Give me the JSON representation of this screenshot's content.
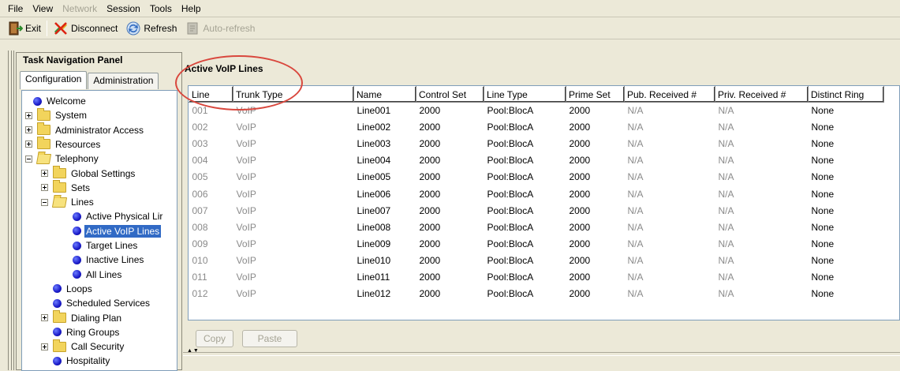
{
  "menu": [
    "File",
    "View",
    "Network",
    "Session",
    "Tools",
    "Help"
  ],
  "menu_disabled": [
    false,
    false,
    true,
    false,
    false,
    false
  ],
  "toolbar": {
    "exit_label": "Exit",
    "disconnect_label": "Disconnect",
    "refresh_label": "Refresh",
    "autorefresh_label": "Auto-refresh"
  },
  "nav": {
    "title": "Task Navigation Panel",
    "tabs": [
      "Configuration",
      "Administration"
    ],
    "active_tab": "Configuration",
    "tree": [
      {
        "label": "Welcome",
        "icon": "blue-dot-icon",
        "depth": 0,
        "expander": "none"
      },
      {
        "label": "System",
        "icon": "folder-icon",
        "depth": 0,
        "expander": "plus"
      },
      {
        "label": "Administrator Access",
        "icon": "folder-icon",
        "depth": 0,
        "expander": "plus"
      },
      {
        "label": "Resources",
        "icon": "folder-icon",
        "depth": 0,
        "expander": "plus"
      },
      {
        "label": "Telephony",
        "icon": "folder-open-icon",
        "depth": 0,
        "expander": "minus"
      },
      {
        "label": "Global Settings",
        "icon": "folder-icon",
        "depth": 1,
        "expander": "plus"
      },
      {
        "label": "Sets",
        "icon": "folder-icon",
        "depth": 1,
        "expander": "plus"
      },
      {
        "label": "Lines",
        "icon": "folder-open-icon",
        "depth": 1,
        "expander": "minus"
      },
      {
        "label": "Active Physical Lir",
        "icon": "blue-dot-icon",
        "depth": 2,
        "expander": "none"
      },
      {
        "label": "Active VoIP Lines",
        "icon": "blue-dot-icon",
        "depth": 2,
        "expander": "none",
        "selected": true
      },
      {
        "label": "Target Lines",
        "icon": "blue-dot-icon",
        "depth": 2,
        "expander": "none"
      },
      {
        "label": "Inactive Lines",
        "icon": "blue-dot-icon",
        "depth": 2,
        "expander": "none"
      },
      {
        "label": "All Lines",
        "icon": "blue-dot-icon",
        "depth": 2,
        "expander": "none"
      },
      {
        "label": "Loops",
        "icon": "blue-dot-icon",
        "depth": 1,
        "expander": "none"
      },
      {
        "label": "Scheduled Services",
        "icon": "blue-dot-icon",
        "depth": 1,
        "expander": "none"
      },
      {
        "label": "Dialing Plan",
        "icon": "folder-icon",
        "depth": 1,
        "expander": "plus"
      },
      {
        "label": "Ring Groups",
        "icon": "blue-dot-icon",
        "depth": 1,
        "expander": "none"
      },
      {
        "label": "Call Security",
        "icon": "folder-icon",
        "depth": 1,
        "expander": "plus"
      },
      {
        "label": "Hospitality",
        "icon": "blue-dot-icon",
        "depth": 1,
        "expander": "none"
      }
    ]
  },
  "main": {
    "title": "Active VoIP Lines",
    "columns": [
      "Line",
      "Trunk Type",
      "Name",
      "Control Set",
      "Line Type",
      "Prime Set",
      "Pub. Received #",
      "Priv. Received #",
      "Distinct Ring"
    ],
    "rows": [
      [
        "001",
        "VoIP",
        "Line001",
        "2000",
        "Pool:BlocA",
        "2000",
        "N/A",
        "N/A",
        "None"
      ],
      [
        "002",
        "VoIP",
        "Line002",
        "2000",
        "Pool:BlocA",
        "2000",
        "N/A",
        "N/A",
        "None"
      ],
      [
        "003",
        "VoIP",
        "Line003",
        "2000",
        "Pool:BlocA",
        "2000",
        "N/A",
        "N/A",
        "None"
      ],
      [
        "004",
        "VoIP",
        "Line004",
        "2000",
        "Pool:BlocA",
        "2000",
        "N/A",
        "N/A",
        "None"
      ],
      [
        "005",
        "VoIP",
        "Line005",
        "2000",
        "Pool:BlocA",
        "2000",
        "N/A",
        "N/A",
        "None"
      ],
      [
        "006",
        "VoIP",
        "Line006",
        "2000",
        "Pool:BlocA",
        "2000",
        "N/A",
        "N/A",
        "None"
      ],
      [
        "007",
        "VoIP",
        "Line007",
        "2000",
        "Pool:BlocA",
        "2000",
        "N/A",
        "N/A",
        "None"
      ],
      [
        "008",
        "VoIP",
        "Line008",
        "2000",
        "Pool:BlocA",
        "2000",
        "N/A",
        "N/A",
        "None"
      ],
      [
        "009",
        "VoIP",
        "Line009",
        "2000",
        "Pool:BlocA",
        "2000",
        "N/A",
        "N/A",
        "None"
      ],
      [
        "010",
        "VoIP",
        "Line010",
        "2000",
        "Pool:BlocA",
        "2000",
        "N/A",
        "N/A",
        "None"
      ],
      [
        "011",
        "VoIP",
        "Line011",
        "2000",
        "Pool:BlocA",
        "2000",
        "N/A",
        "N/A",
        "None"
      ],
      [
        "012",
        "VoIP",
        "Line012",
        "2000",
        "Pool:BlocA",
        "2000",
        "N/A",
        "N/A",
        "None"
      ]
    ],
    "copy_label": "Copy",
    "paste_label": "Paste"
  },
  "colors": {
    "window_bg": "#ece9d8",
    "selection": "#316ac5",
    "annotation_circle": "#d9473d",
    "disabled_text": "#a5a394"
  }
}
